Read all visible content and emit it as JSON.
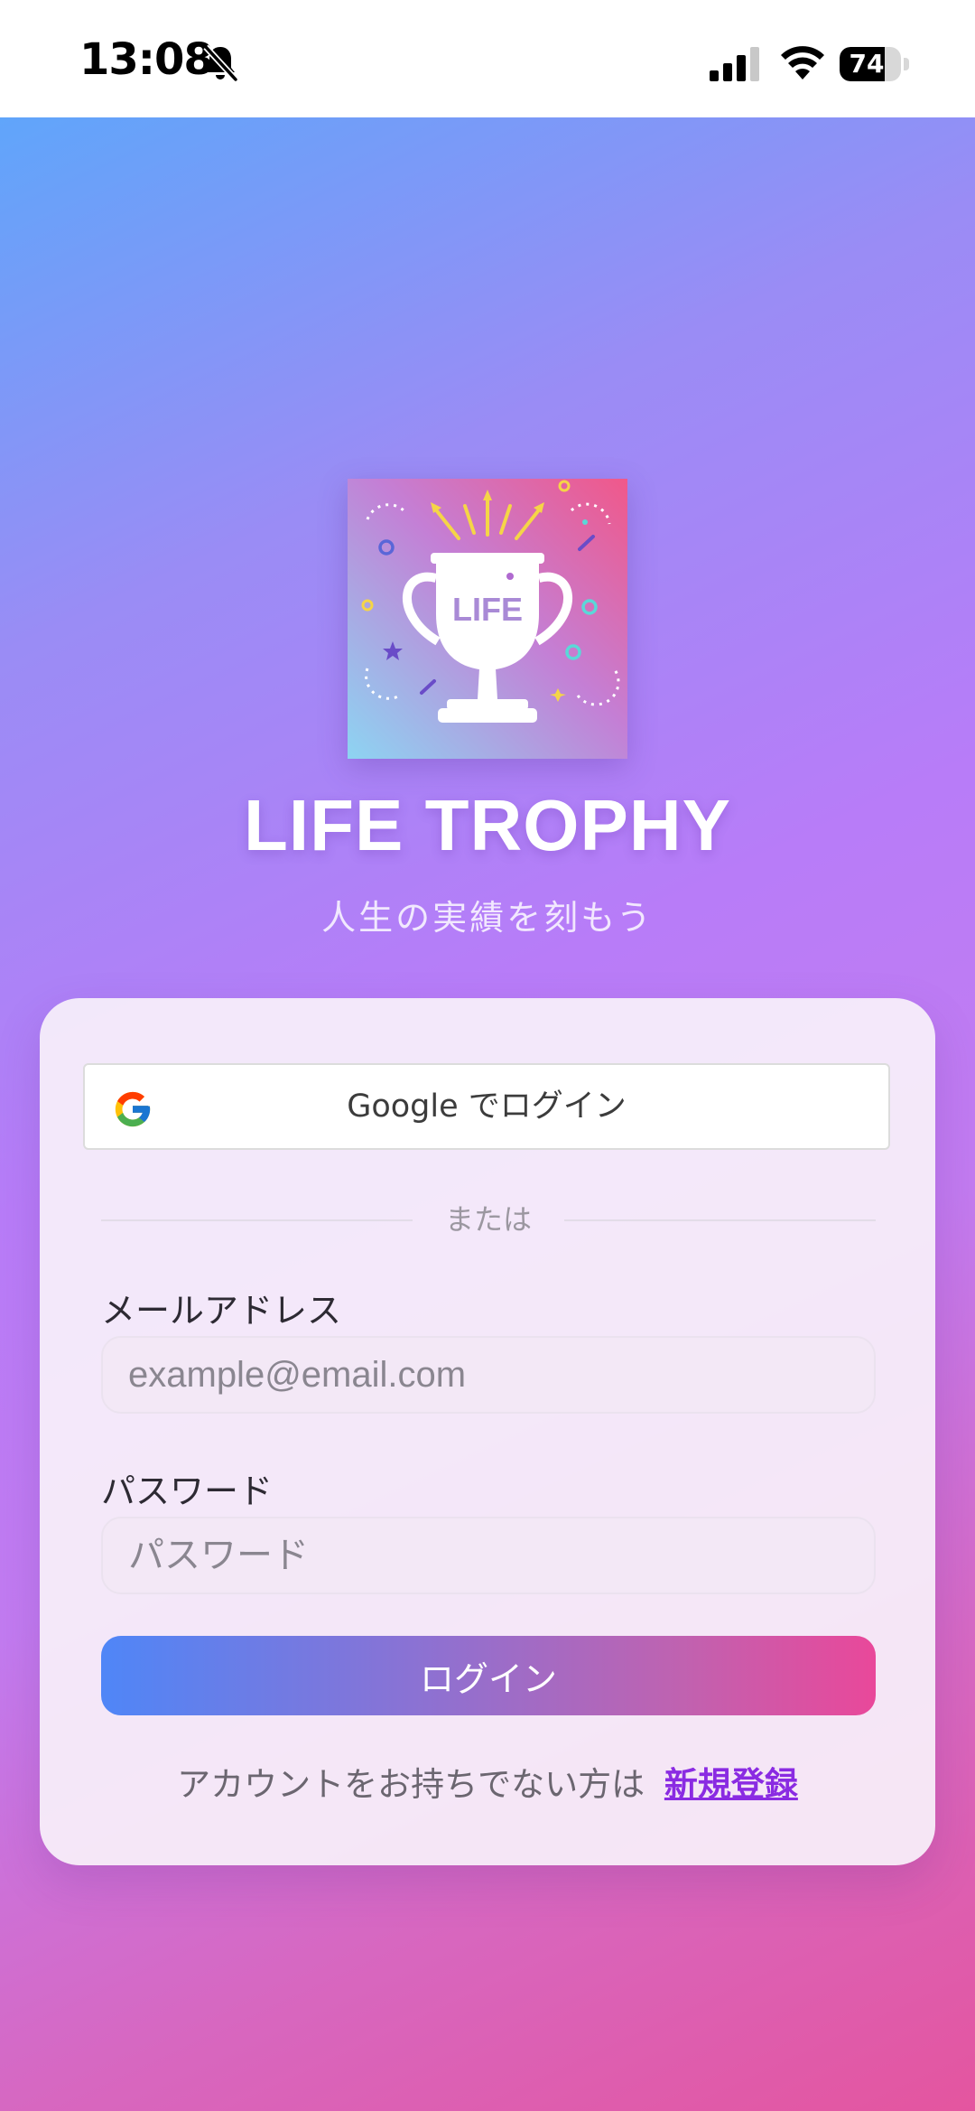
{
  "status_bar": {
    "time": "13:08",
    "battery_level": "74",
    "battery_percent": 74,
    "icons": [
      "bell-slash-icon",
      "signal-icon",
      "wifi-icon",
      "battery-icon"
    ]
  },
  "app": {
    "logo_text": "LIFE",
    "title": "LIFE TROPHY",
    "subtitle": "人生の実績を刻もう"
  },
  "login": {
    "google_button_label": "Google でログイン",
    "divider_text": "または",
    "email_label": "メールアドレス",
    "email_placeholder": "example@email.com",
    "email_value": "",
    "password_label": "パスワード",
    "password_placeholder": "パスワード",
    "password_value": "",
    "login_button_label": "ログイン",
    "signup_prompt": "アカウントをお持ちでない方は",
    "signup_link": "新規登録"
  },
  "colors": {
    "background_start": "#60a5fa",
    "background_mid": "#b87cf8",
    "background_end": "#e4559f",
    "button_start": "#4f86f7",
    "button_end": "#e9489a",
    "link": "#8a2be2"
  }
}
